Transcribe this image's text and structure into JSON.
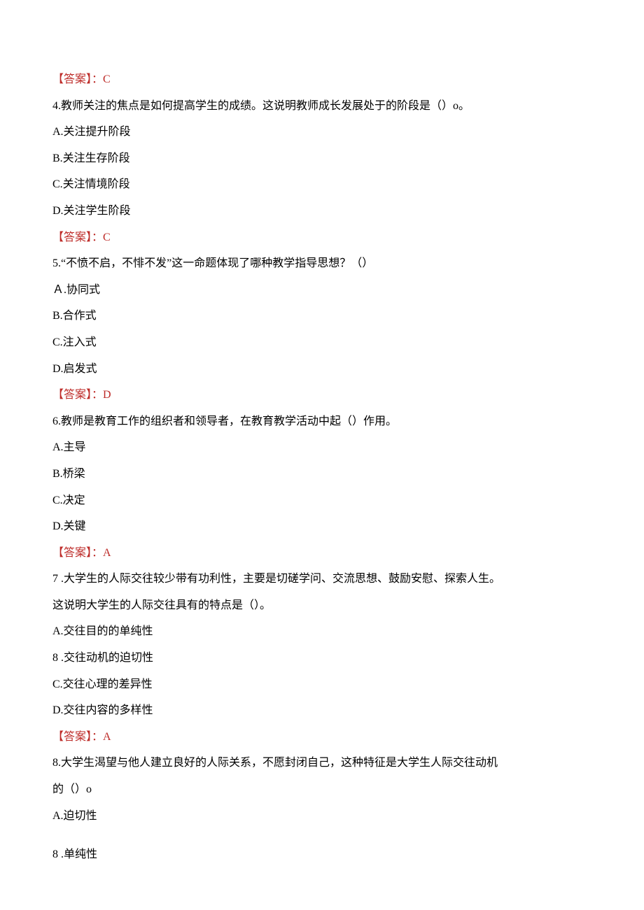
{
  "answerPrefix": "【答案】：",
  "q3": {
    "answerLetter": "C"
  },
  "q4": {
    "stem": "4.教师关注的焦点是如何提高学生的成绩。这说明教师成长发展处于的阶段是（）o。",
    "optA": "A.关注提升阶段",
    "optB": "B.关注生存阶段",
    "optC": "C.关注情境阶段",
    "optD": "D.关注学生阶段",
    "answerLetter": "C"
  },
  "q5": {
    "stem": "5.“不愤不启，不悱不发”这一命题体现了哪种教学指导思想？（）",
    "optA": "Ａ.协同式",
    "optB": "B.合作式",
    "optC": "C.注入式",
    "optD": "D.启发式",
    "answerLetter": "D"
  },
  "q6": {
    "stem": "6.教师是教育工作的组织者和领导者，在教育教学活动中起（）作用。",
    "optA": "A.主导",
    "optB": "B.桥梁",
    "optC": "C.决定",
    "optD": "D.关键",
    "answerLetter": "A"
  },
  "q7": {
    "stemLine1": "7 .大学生的人际交往较少带有功利性，主要是切磋学问、交流思想、鼓励安慰、探索人生。",
    "stemLine2": "这说明大学生的人际交往具有的特点是（）。",
    "optA": "A.交往目的的单纯性",
    "optB": "8 .交往动机的迫切性",
    "optC": "C.交往心理的差异性",
    "optD": "D.交往内容的多样性",
    "answerLetter": "A"
  },
  "q8": {
    "stemLine1": "8.大学生渴望与他人建立良好的人际关系，不愿封闭自己，这种特征是大学生人际交往动机",
    "stemLine2": "的（）o",
    "optA": "A.迫切性",
    "optB": "8 .单纯性"
  }
}
